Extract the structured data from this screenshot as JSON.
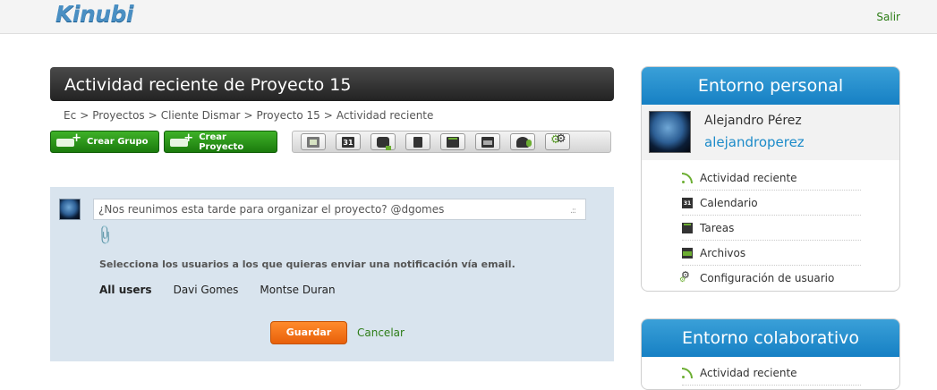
{
  "header": {
    "logo": "Kinubi",
    "logout_label": "Salir"
  },
  "main": {
    "title": "Actividad reciente de Proyecto 15",
    "breadcrumb": [
      "Ec",
      "Proyectos",
      "Cliente Dismar",
      "Proyecto 15",
      "Actividad reciente"
    ],
    "buttons": {
      "create_group": "Crear Grupo",
      "create_project": "Crear Proyecto"
    },
    "toolbar_icons": [
      "news-icon",
      "calendar-icon",
      "chat-icon",
      "document-icon",
      "tasks-icon",
      "folder-icon",
      "users-icon",
      "settings-icon"
    ],
    "calendar_day": "31"
  },
  "post": {
    "input_value": "¿Nos reunimos esta tarde para organizar el proyecto? @dgomes",
    "notify_text": "Selecciona los usuarios a los que quieras enviar una notificación vía email.",
    "users": [
      "All users",
      "Davi Gomes",
      "Montse Duran"
    ],
    "save_label": "Guardar",
    "cancel_label": "Cancelar"
  },
  "sidebar": {
    "personal": {
      "title": "Entorno personal",
      "name": "Alejandro Pérez",
      "username": "alejandroperez",
      "items": [
        {
          "icon": "rss-icon",
          "label": "Actividad reciente"
        },
        {
          "icon": "calendar-icon",
          "label": "Calendario"
        },
        {
          "icon": "tasks-icon",
          "label": "Tareas"
        },
        {
          "icon": "folder-icon",
          "label": "Archivos"
        },
        {
          "icon": "settings-icon",
          "label": "Configuración de usuario"
        }
      ]
    },
    "collab": {
      "title": "Entorno colaborativo",
      "items": [
        {
          "icon": "rss-icon",
          "label": "Actividad reciente"
        }
      ]
    }
  },
  "colors": {
    "accent_blue": "#1680c4",
    "green": "#2d7d17",
    "orange": "#e8600a",
    "panel_bg": "#d9e4ee"
  }
}
